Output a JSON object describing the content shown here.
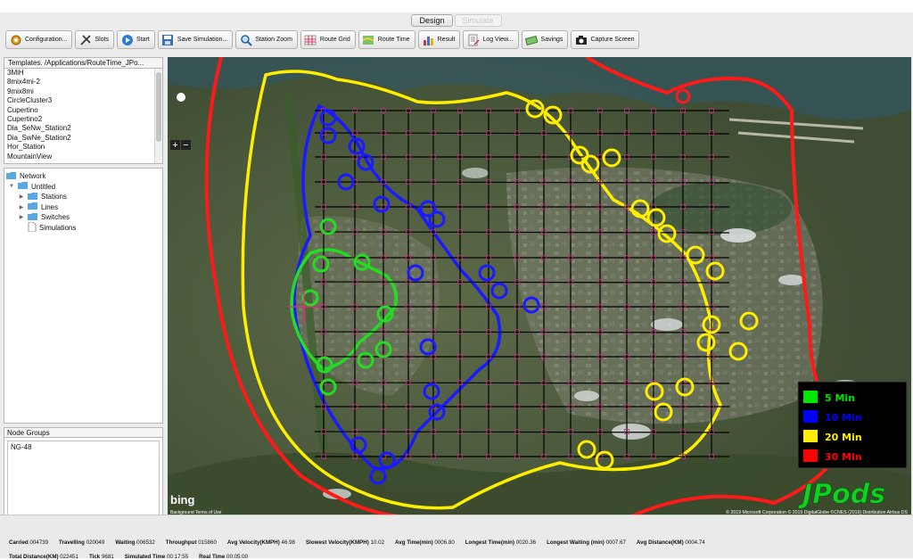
{
  "tabs": [
    {
      "label": "Design",
      "active": true
    },
    {
      "label": "Simulate",
      "active": false
    }
  ],
  "toolbar": [
    {
      "label": "Configuration...",
      "icon": "gear-icon"
    },
    {
      "label": "Slots",
      "icon": "slots-icon"
    },
    {
      "label": "Start",
      "icon": "play-icon"
    },
    {
      "label": "Save Simulation...",
      "icon": "save-icon"
    },
    {
      "label": "Station Zoom",
      "icon": "magnifier-icon"
    },
    {
      "label": "Route Grid",
      "icon": "grid-icon"
    },
    {
      "label": "Route Time",
      "icon": "map-icon"
    },
    {
      "label": "Result",
      "icon": "bar-chart-icon"
    },
    {
      "label": "Log View...",
      "icon": "log-icon"
    },
    {
      "label": "Savings",
      "icon": "money-icon"
    },
    {
      "label": "Capture Screen",
      "icon": "camera-icon"
    }
  ],
  "templates": {
    "header": "Templates. /Applications/RouteTime_JPo...",
    "items": [
      "3MiH",
      "8mix4mi-2",
      "9mix8mi",
      "CircleCluster3",
      "Cupertino",
      "Cupertino2",
      "Dia_SeNw_Station2",
      "Dia_SwNe_Station2",
      "Hor_Station",
      "MountainView"
    ]
  },
  "network": {
    "root": "Network",
    "project": "Untitled",
    "children": [
      "Stations",
      "Lines",
      "Switches",
      "Simulations"
    ]
  },
  "node_groups": {
    "header": "Node Groups",
    "items": [
      "NG-48"
    ]
  },
  "map": {
    "zoom_plus": "+",
    "zoom_minus": "−",
    "bing_logo": "bing",
    "bing_sub": "Background Terms of Use",
    "copyright": "© 2019 Microsoft Corporation © 2019 DigitalGlobe ©CNES (2019) Distribution Airbus DS",
    "watermark": "JPods",
    "legend": [
      {
        "label": "5 Min",
        "color": "#00e600"
      },
      {
        "label": "10 Min",
        "color": "#0000ff"
      },
      {
        "label": "20 Min",
        "color": "#ffee00"
      },
      {
        "label": "30 Min",
        "color": "#ff0000"
      }
    ],
    "colors": {
      "five": "#22dd22",
      "ten": "#1a1aff",
      "twenty": "#ffee00",
      "thirty": "#ff1a1a",
      "grid": "#000000"
    }
  },
  "status": {
    "row1": [
      {
        "label": "Carried",
        "value": "004739"
      },
      {
        "label": "Travelling",
        "value": "020049"
      },
      {
        "label": "Waiting",
        "value": "006532"
      },
      {
        "label": "Throughput",
        "value": "015860"
      },
      {
        "label": "Avg Velocity(KMPH)",
        "value": "46.98"
      },
      {
        "label": "Slowest Velocity(KMPH)",
        "value": "10.02"
      },
      {
        "label": "Avg Time(min)",
        "value": "0006.80"
      },
      {
        "label": "Longest Time(min)",
        "value": "0020.36"
      },
      {
        "label": "Longest Waiting (min)",
        "value": "0007.67"
      },
      {
        "label": "Avg Distance(KM)",
        "value": "0004.74"
      }
    ],
    "row2": [
      {
        "label": "Total Distance(KM)",
        "value": "022451"
      },
      {
        "label": "Tick",
        "value": "9681"
      },
      {
        "label": "Simulated Time",
        "value": "00:17:55"
      },
      {
        "label": "Real Time",
        "value": "00:05:00"
      }
    ]
  }
}
